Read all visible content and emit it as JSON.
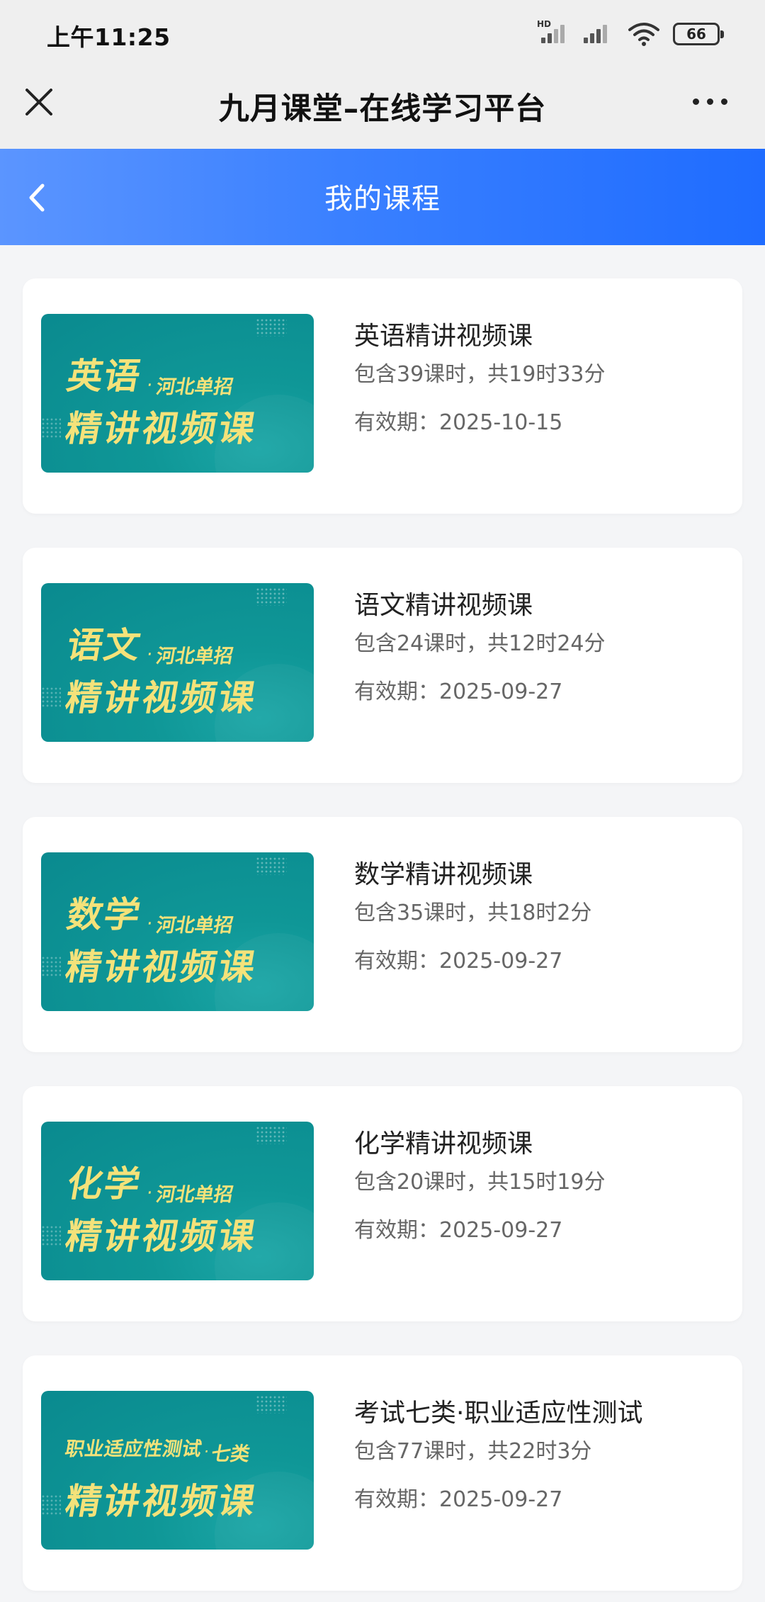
{
  "status_bar": {
    "time": "上午11:25",
    "network_badge": "HD",
    "battery": "66"
  },
  "title_bar": {
    "title": "九月课堂–在线学习平台"
  },
  "header": {
    "title": "我的课程"
  },
  "courses": [
    {
      "thumb_subject": "英语",
      "thumb_tag": "河北单招",
      "thumb_main": "精讲视频课",
      "title": "英语精讲视频课",
      "meta": "包含39课时，共19时33分",
      "expiry": "有效期：2025-10-15"
    },
    {
      "thumb_subject": "语文",
      "thumb_tag": "河北单招",
      "thumb_main": "精讲视频课",
      "title": "语文精讲视频课",
      "meta": "包含24课时，共12时24分",
      "expiry": "有效期：2025-09-27"
    },
    {
      "thumb_subject": "数学",
      "thumb_tag": "河北单招",
      "thumb_main": "精讲视频课",
      "title": "数学精讲视频课",
      "meta": "包含35课时，共18时2分",
      "expiry": "有效期：2025-09-27"
    },
    {
      "thumb_subject": "化学",
      "thumb_tag": "河北单招",
      "thumb_main": "精讲视频课",
      "title": "化学精讲视频课",
      "meta": "包含20课时，共15时19分",
      "expiry": "有效期：2025-09-27"
    },
    {
      "thumb_subject": "职业适应性测试",
      "thumb_tag": "七类",
      "thumb_main": "精讲视频课",
      "title": "考试七类·职业适应性测试",
      "meta": "包含77课时，共22时3分",
      "expiry": "有效期：2025-09-27"
    }
  ],
  "icons": {
    "close": "close-icon",
    "more": "more-icon",
    "back": "chevron-left-icon",
    "signal": "signal-icon",
    "wifi": "wifi-icon",
    "battery": "battery-icon"
  },
  "colors": {
    "header_gradient_start": "#5b95ff",
    "header_gradient_end": "#1f6cff",
    "thumb_bg": "#0f9797",
    "thumb_text": "#f4e27a"
  }
}
